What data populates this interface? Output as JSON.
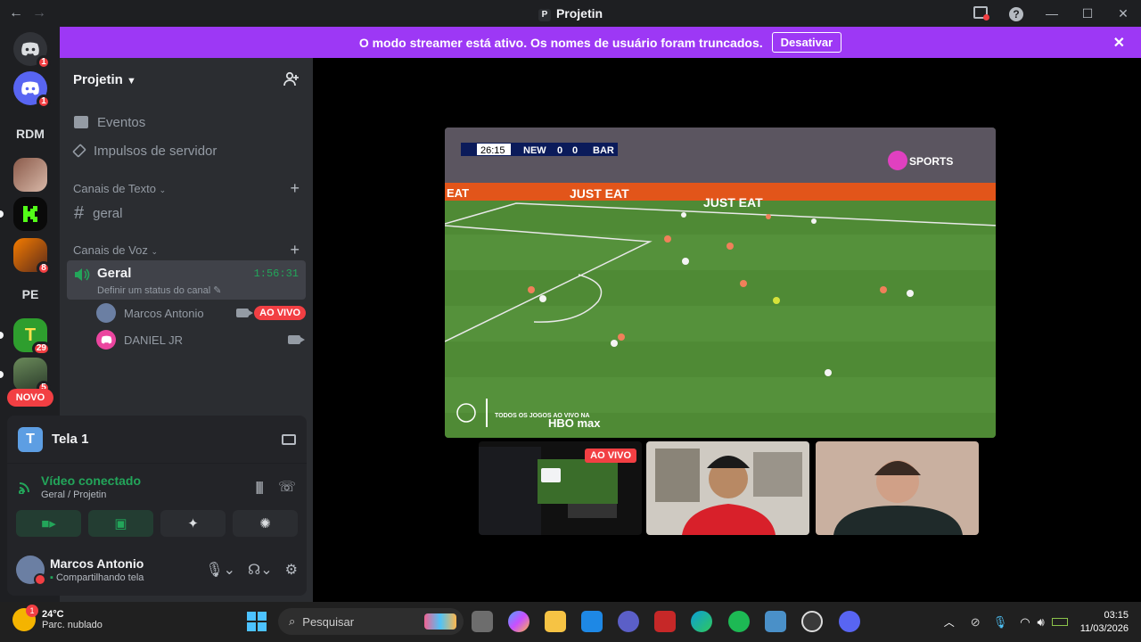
{
  "window": {
    "title": "Projetin",
    "title_badge": "P"
  },
  "banner": {
    "message": "O modo streamer está ativo. Os nomes de usuário foram truncados.",
    "button": "Desativar"
  },
  "servers": [
    {
      "label": "",
      "badge": "1"
    },
    {
      "label": "",
      "badge": "1"
    },
    {
      "label": "RDM",
      "badge": ""
    },
    {
      "label": "",
      "badge": ""
    },
    {
      "label": "",
      "badge": ""
    },
    {
      "label": "",
      "badge": "8"
    },
    {
      "label": "PE",
      "badge": ""
    },
    {
      "label": "",
      "badge": "29"
    },
    {
      "label": "",
      "badge": "5"
    }
  ],
  "servers_new_label": "NOVO",
  "sidebar": {
    "guild_name": "Projetin",
    "events": "Eventos",
    "boosts": "Impulsos de servidor",
    "text_category": "Canais de Texto",
    "text_channel": "geral",
    "voice_category": "Canais de Voz",
    "voice_channel": "Geral",
    "voice_timer": "1:56:31",
    "voice_status": "Definir um status do canal",
    "voice_users": [
      {
        "name": "Marcos Antonio",
        "live": "AO VIVO"
      },
      {
        "name": "DANIEL JR",
        "live": ""
      }
    ]
  },
  "panel": {
    "screen_title": "Tela 1",
    "screen_icon_letter": "T",
    "connection": "Vídeo conectado",
    "connection_sub": "Geral / Projetin",
    "username": "Marcos Antonio",
    "user_status": "Compartilhando tela"
  },
  "stream": {
    "clock": "26:15",
    "home": "NEW",
    "home_score": "0",
    "away_score": "0",
    "away": "BAR",
    "broadcaster": "SPORTS",
    "ad_board": "JUST EAT",
    "ad_board_short": "EAT",
    "promo": "TODOS OS JOGOS AO VIVO NA",
    "promo_brand": "HBO max",
    "tile_live": "AO VIVO"
  },
  "taskbar": {
    "temp": "24°C",
    "weather": "Parc. nublado",
    "weather_badge": "1",
    "search_placeholder": "Pesquisar",
    "time": "03:15",
    "date": "11/03/2026"
  }
}
